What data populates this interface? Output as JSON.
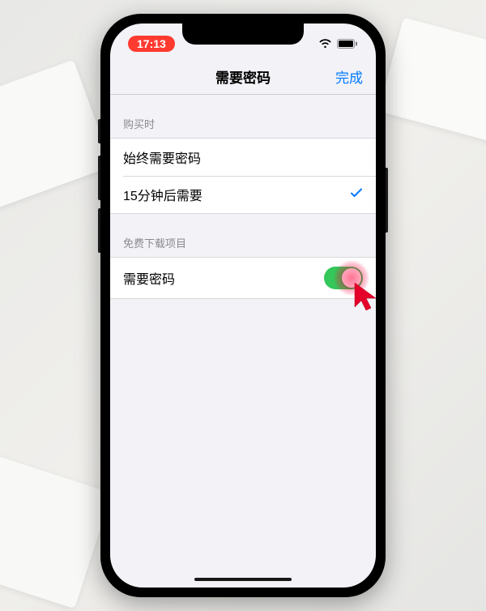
{
  "status": {
    "time": "17:13"
  },
  "nav": {
    "title": "需要密码",
    "done": "完成"
  },
  "sections": {
    "purchase": {
      "header": "购买时",
      "option_always": "始终需要密码",
      "option_15min": "15分钟后需要"
    },
    "free": {
      "header": "免费下载项目",
      "require_password": "需要密码"
    }
  },
  "colors": {
    "accent": "#007aff",
    "switch_on": "#34c759",
    "time_pill": "#ff3b30",
    "cursor": "#e4002b"
  }
}
